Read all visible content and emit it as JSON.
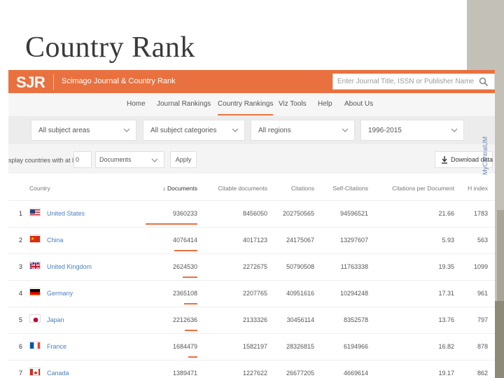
{
  "slide": {
    "title": "Country Rank",
    "watermark": "MyCentralUM"
  },
  "header": {
    "logo": "SJR",
    "brand": "Scimago Journal & Country Rank",
    "search_placeholder": "Enter Journal Title, ISSN or Publisher Name",
    "accent_color": "#e9713f"
  },
  "nav": {
    "items": [
      "Home",
      "Journal Rankings",
      "Country Rankings",
      "Viz Tools",
      "Help",
      "About Us"
    ],
    "active": "Country Rankings"
  },
  "filters": {
    "subject_areas": "All subject areas",
    "subject_categories": "All subject categories",
    "regions": "All regions",
    "years": "1996-2015"
  },
  "toolbar": {
    "display_label": "splay countries with at least",
    "min_value": "0",
    "metric_select": "Documents",
    "apply_label": "Apply",
    "download_label": "Download data"
  },
  "table": {
    "columns": [
      "Country",
      "Documents",
      "Citable documents",
      "Citations",
      "Self-Citations",
      "Citations per Document",
      "H index"
    ],
    "rows": [
      {
        "rank": "1",
        "country": "United States",
        "flag": "us-flag-icon",
        "documents": "9360233",
        "citable": "8456050",
        "citations": "202750565",
        "self_citations": "94596521",
        "cpd": "21.66",
        "h": "1783",
        "bar": 1.0
      },
      {
        "rank": "2",
        "country": "China",
        "flag": "cn-flag-icon",
        "documents": "4076414",
        "citable": "4017123",
        "citations": "24175067",
        "self_citations": "13297607",
        "cpd": "5.93",
        "h": "563",
        "bar": 0.44
      },
      {
        "rank": "3",
        "country": "United Kingdom",
        "flag": "gb-flag-icon",
        "documents": "2624530",
        "citable": "2272675",
        "citations": "50790508",
        "self_citations": "11763338",
        "cpd": "19.35",
        "h": "1099",
        "bar": 0.28
      },
      {
        "rank": "4",
        "country": "Germany",
        "flag": "de-flag-icon",
        "documents": "2365108",
        "citable": "2207765",
        "citations": "40951616",
        "self_citations": "10294248",
        "cpd": "17.31",
        "h": "961",
        "bar": 0.25
      },
      {
        "rank": "5",
        "country": "Japan",
        "flag": "jp-flag-icon",
        "documents": "2212636",
        "citable": "2133326",
        "citations": "30456114",
        "self_citations": "8352578",
        "cpd": "13.76",
        "h": "797",
        "bar": 0.24
      },
      {
        "rank": "6",
        "country": "France",
        "flag": "fr-flag-icon",
        "documents": "1684479",
        "citable": "1582197",
        "citations": "28326815",
        "self_citations": "6194966",
        "cpd": "16.82",
        "h": "878",
        "bar": 0.18
      },
      {
        "rank": "7",
        "country": "Canada",
        "flag": "ca-flag-icon",
        "documents": "1389471",
        "citable": "1227622",
        "citations": "26677205",
        "self_citations": "4669614",
        "cpd": "19.17",
        "h": "862",
        "bar": 0.15
      }
    ]
  }
}
